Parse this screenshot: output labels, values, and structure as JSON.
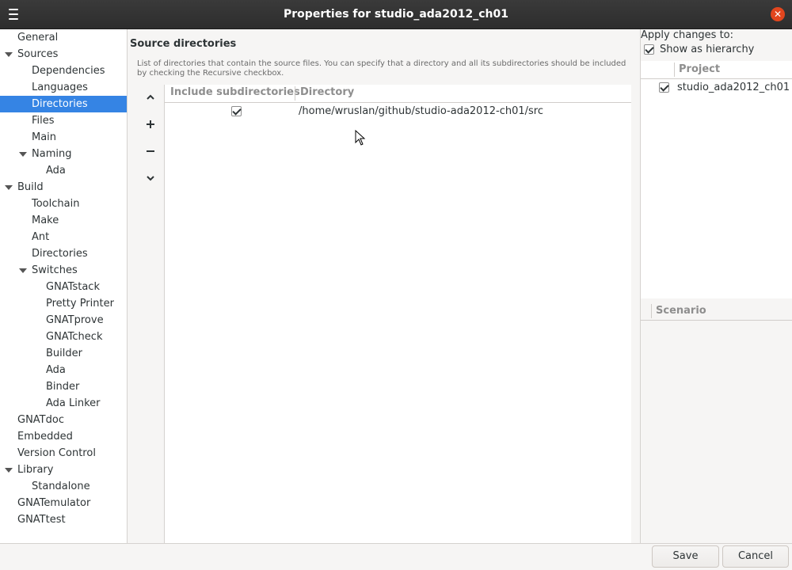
{
  "window": {
    "title": "Properties for studio_ada2012_ch01",
    "menu_icon": "hamburger-icon",
    "close_icon": "close-icon"
  },
  "sidebar": {
    "items": [
      {
        "label": "General",
        "level": 1,
        "expanded": null
      },
      {
        "label": "Sources",
        "level": 1,
        "expanded": true
      },
      {
        "label": "Dependencies",
        "level": 2,
        "expanded": null
      },
      {
        "label": "Languages",
        "level": 2,
        "expanded": null
      },
      {
        "label": "Directories",
        "level": 2,
        "expanded": null,
        "selected": true
      },
      {
        "label": "Files",
        "level": 2,
        "expanded": null
      },
      {
        "label": "Main",
        "level": 2,
        "expanded": null
      },
      {
        "label": "Naming",
        "level": 2,
        "expanded": true
      },
      {
        "label": "Ada",
        "level": 3,
        "expanded": null
      },
      {
        "label": "Build",
        "level": 1,
        "expanded": true
      },
      {
        "label": "Toolchain",
        "level": 2,
        "expanded": null
      },
      {
        "label": "Make",
        "level": 2,
        "expanded": null
      },
      {
        "label": "Ant",
        "level": 2,
        "expanded": null
      },
      {
        "label": "Directories",
        "level": 2,
        "expanded": null
      },
      {
        "label": "Switches",
        "level": 2,
        "expanded": true
      },
      {
        "label": "GNATstack",
        "level": 3,
        "expanded": null
      },
      {
        "label": "Pretty Printer",
        "level": 3,
        "expanded": null
      },
      {
        "label": "GNATprove",
        "level": 3,
        "expanded": null
      },
      {
        "label": "GNATcheck",
        "level": 3,
        "expanded": null
      },
      {
        "label": "Builder",
        "level": 3,
        "expanded": null
      },
      {
        "label": "Ada",
        "level": 3,
        "expanded": null
      },
      {
        "label": "Binder",
        "level": 3,
        "expanded": null
      },
      {
        "label": "Ada Linker",
        "level": 3,
        "expanded": null
      },
      {
        "label": "GNATdoc",
        "level": 1,
        "expanded": null
      },
      {
        "label": "Embedded",
        "level": 1,
        "expanded": null
      },
      {
        "label": "Version Control",
        "level": 1,
        "expanded": null
      },
      {
        "label": "Library",
        "level": 1,
        "expanded": true
      },
      {
        "label": "Standalone",
        "level": 2,
        "expanded": null
      },
      {
        "label": "GNATemulator",
        "level": 1,
        "expanded": null
      },
      {
        "label": "GNATtest",
        "level": 1,
        "expanded": null
      }
    ]
  },
  "main": {
    "title": "Source directories",
    "description": "List of directories that contain the source files. You can specify that a directory and all its subdirectories should be included by checking the Recursive checkbox.",
    "tools": [
      {
        "icon": "chevron-up-icon",
        "glyph": "⌃"
      },
      {
        "icon": "plus-icon",
        "glyph": "+"
      },
      {
        "icon": "minus-icon",
        "glyph": "−"
      },
      {
        "icon": "chevron-down-icon",
        "glyph": "⌄"
      }
    ],
    "columns": {
      "include_subdirs": "Include subdirectories",
      "directory": "Directory"
    },
    "rows": [
      {
        "include_subdirs": true,
        "directory": "/home/wruslan/github/studio-ada2012-ch01/src"
      }
    ]
  },
  "right_panel": {
    "apply_label": "Apply changes to:",
    "show_hierarchy_label": "Show as hierarchy",
    "show_hierarchy_checked": true,
    "project_header": "Project",
    "projects": [
      {
        "name": "studio_ada2012_ch01",
        "checked": true
      }
    ],
    "scenario_header": "Scenario"
  },
  "footer": {
    "save_label": "Save",
    "cancel_label": "Cancel"
  },
  "colors": {
    "selection": "#3584e4",
    "titlebar": "#2d2d2d",
    "close_button": "#e2461e"
  }
}
